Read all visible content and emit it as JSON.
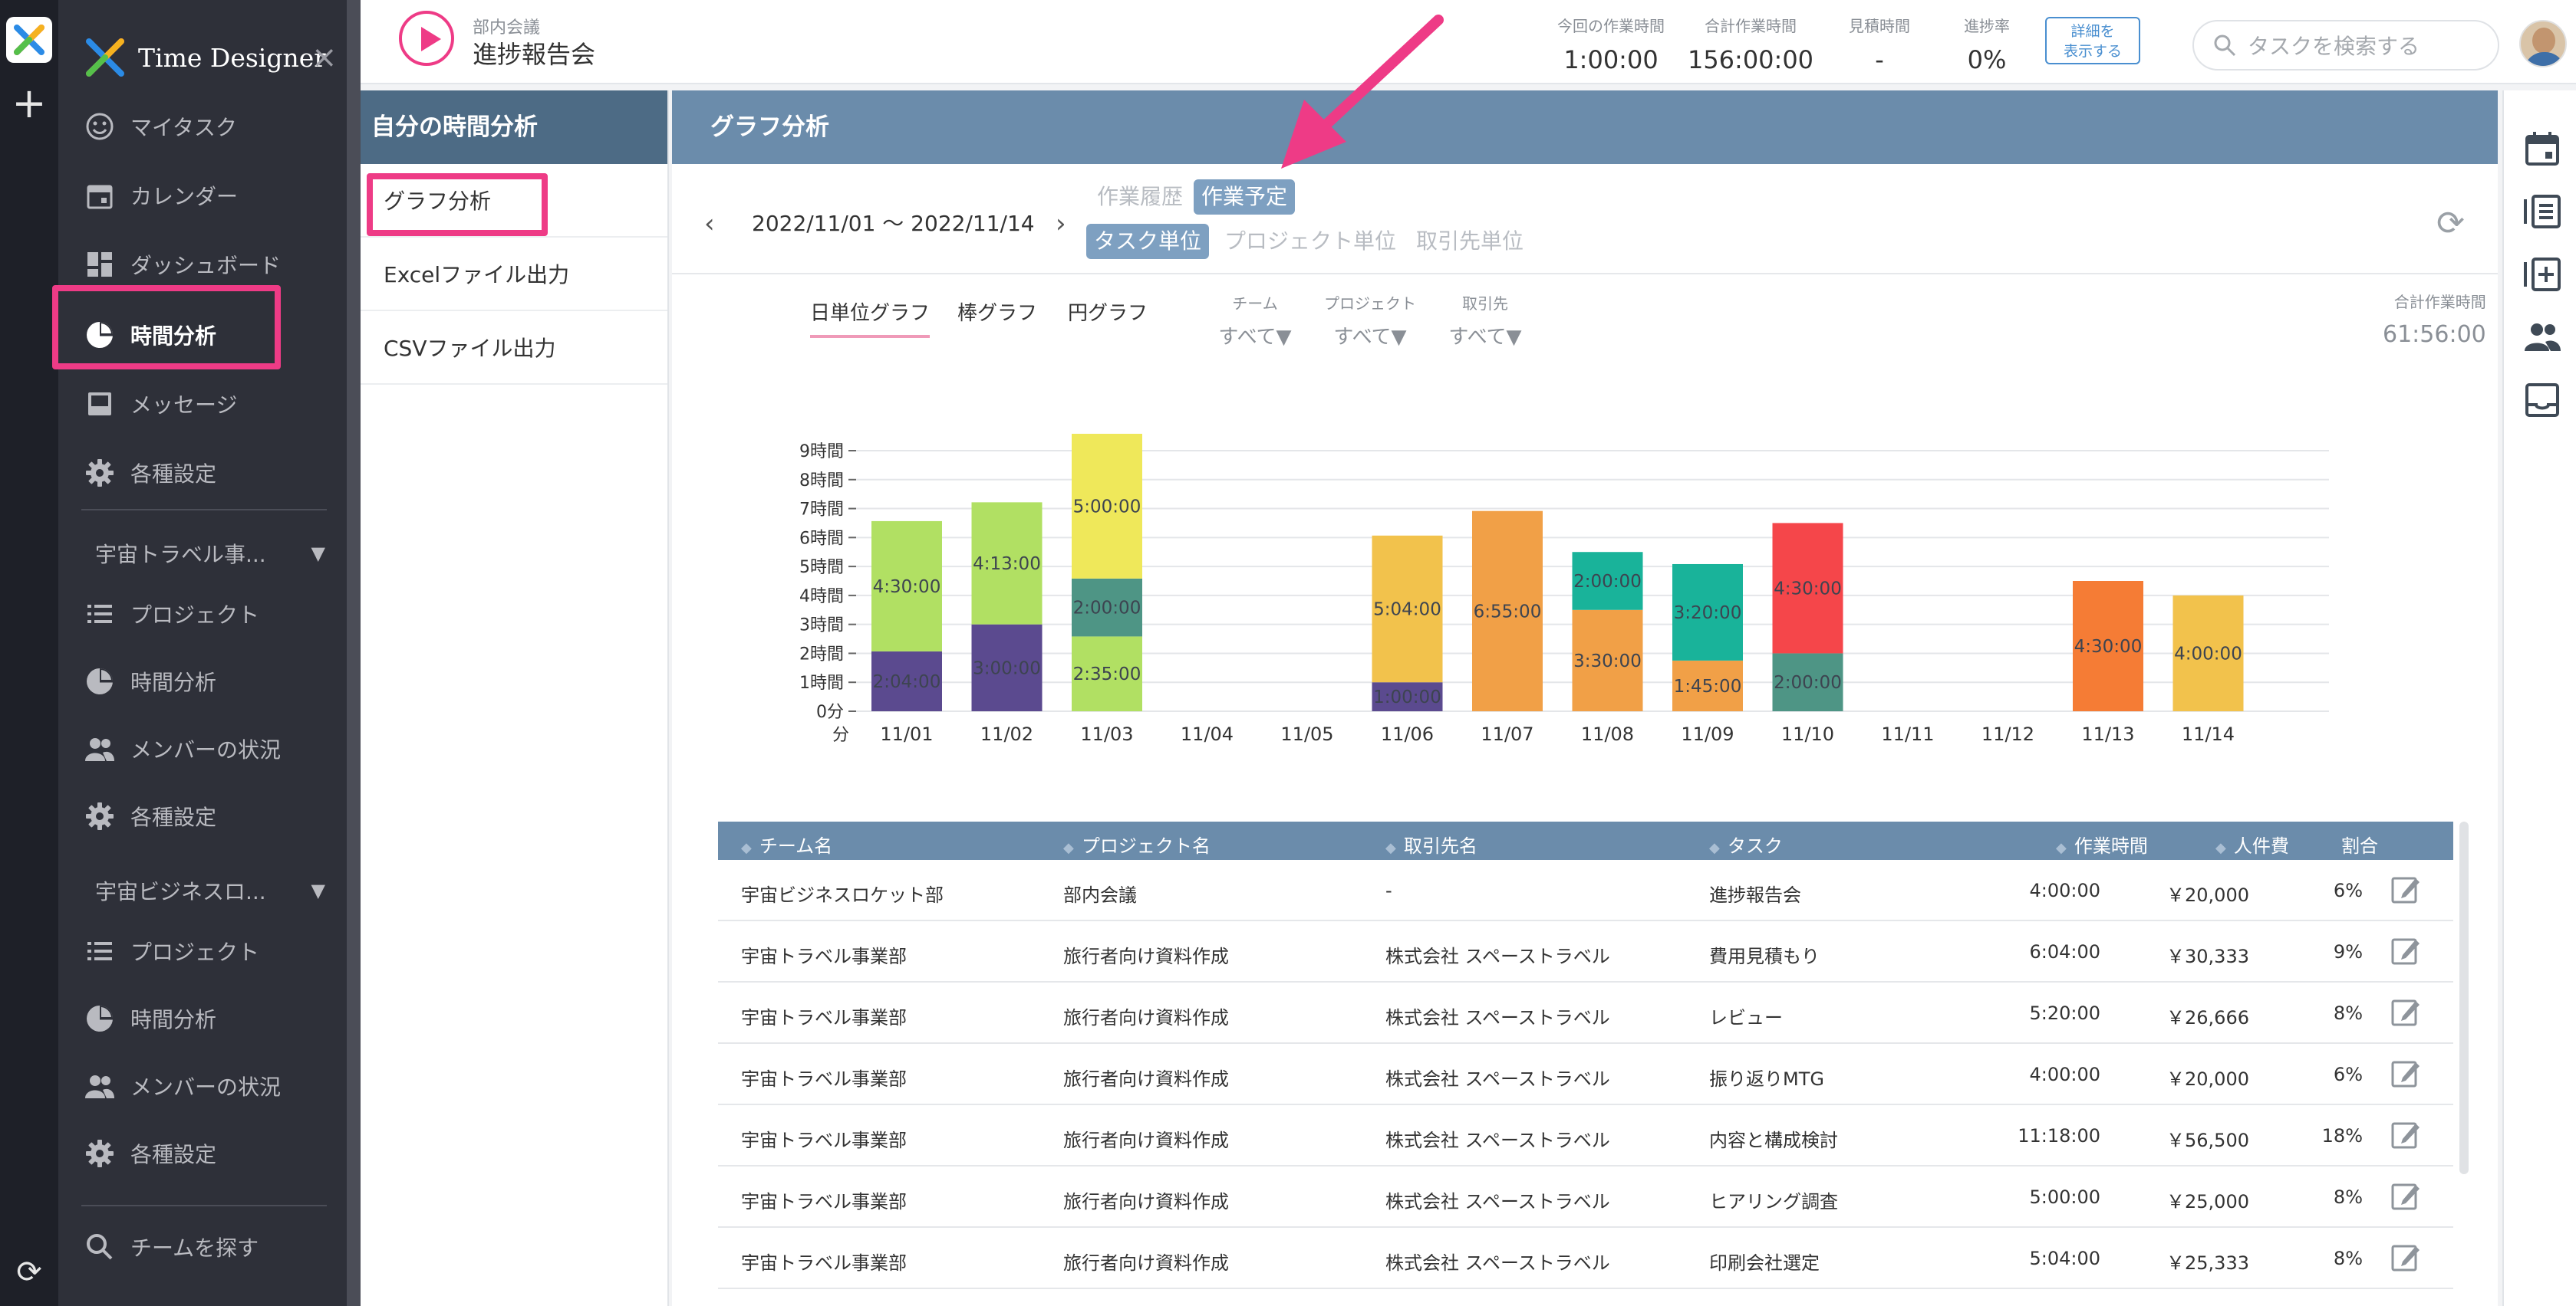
{
  "app": {
    "name": "Time Designer",
    "colors": {
      "accent": "#ee3b86",
      "sidebar": "#2e3039",
      "header": "#6b8cab",
      "subheader": "#4d6b85"
    }
  },
  "sidebar": {
    "items": [
      {
        "label": "マイタスク",
        "icon": "smiley-icon"
      },
      {
        "label": "カレンダー",
        "icon": "calendar-icon"
      },
      {
        "label": "ダッシュボード",
        "icon": "dashboard-icon"
      },
      {
        "label": "時間分析",
        "icon": "pie-chart-icon"
      },
      {
        "label": "メッセージ",
        "icon": "inbox-icon"
      },
      {
        "label": "各種設定",
        "icon": "gear-icon"
      }
    ],
    "groups": [
      {
        "name": "宇宙トラベル事...",
        "items": [
          {
            "label": "プロジェクト",
            "icon": "list-icon"
          },
          {
            "label": "時間分析",
            "icon": "pie-chart-icon"
          },
          {
            "label": "メンバーの状況",
            "icon": "people-icon"
          },
          {
            "label": "各種設定",
            "icon": "gear-icon"
          }
        ]
      },
      {
        "name": "宇宙ビジネスロ...",
        "items": [
          {
            "label": "プロジェクト",
            "icon": "list-icon"
          },
          {
            "label": "時間分析",
            "icon": "pie-chart-icon"
          },
          {
            "label": "メンバーの状況",
            "icon": "people-icon"
          },
          {
            "label": "各種設定",
            "icon": "gear-icon"
          }
        ]
      }
    ],
    "find_team": "チームを探す"
  },
  "topbar": {
    "task_category": "部内会議",
    "task_name": "進捗報告会",
    "stats": [
      {
        "label": "今回の作業時間",
        "value": "1:00:00"
      },
      {
        "label": "合計作業時間",
        "value": "156:00:00"
      },
      {
        "label": "見積時間",
        "value": "-"
      },
      {
        "label": "進捗率",
        "value": "0%"
      }
    ],
    "detail_button": [
      "詳細を",
      "表示する"
    ],
    "search_placeholder": "タスクを検索する"
  },
  "subnav": {
    "title": "自分の時間分析",
    "items": [
      "グラフ分析",
      "Excelファイル出力",
      "CSVファイル出力"
    ]
  },
  "main": {
    "title": "グラフ分析",
    "date_range": "2022/11/01 〜 2022/11/14",
    "mode_toggle": [
      {
        "label": "作業履歴",
        "active": false
      },
      {
        "label": "作業予定",
        "active": true
      }
    ],
    "unit_toggle": [
      {
        "label": "タスク単位",
        "active": true
      },
      {
        "label": "プロジェクト単位",
        "active": false
      },
      {
        "label": "取引先単位",
        "active": false
      }
    ],
    "chart_tabs": [
      "日単位グラフ",
      "棒グラフ",
      "円グラフ"
    ],
    "filters": [
      {
        "label": "チーム",
        "value": "すべて▼"
      },
      {
        "label": "プロジェクト",
        "value": "すべて▼"
      },
      {
        "label": "取引先",
        "value": "すべて▼"
      }
    ],
    "total_label": "合計作業時間",
    "total_value": "61:56:00"
  },
  "chart_data": {
    "type": "bar",
    "stacked": true,
    "categories": [
      "11/01",
      "11/02",
      "11/03",
      "11/04",
      "11/05",
      "11/06",
      "11/07",
      "11/08",
      "11/09",
      "11/10",
      "11/11",
      "11/12",
      "11/13",
      "11/14"
    ],
    "y_tick_labels": [
      "0分",
      "1時間",
      "2時間",
      "3時間",
      "4時間",
      "5時間",
      "6時間",
      "7時間",
      "8時間",
      "9時間"
    ],
    "x_corner_label": "分",
    "ylim": [
      0,
      9
    ],
    "grid": true,
    "stacks": [
      [
        {
          "value": 2.067,
          "label": "2:04:00",
          "color": "#5b4a8f"
        },
        {
          "value": 4.5,
          "label": "4:30:00",
          "color": "#b1e063"
        }
      ],
      [
        {
          "value": 3.0,
          "label": "3:00:00",
          "color": "#5b4a8f"
        },
        {
          "value": 4.217,
          "label": "4:13:00",
          "color": "#b1e063"
        }
      ],
      [
        {
          "value": 2.583,
          "label": "2:35:00",
          "color": "#b1e063"
        },
        {
          "value": 2.0,
          "label": "2:00:00",
          "color": "#4e9585"
        },
        {
          "value": 5.0,
          "label": "5:00:00",
          "color": "#efe85a"
        }
      ],
      [],
      [],
      [
        {
          "value": 1.0,
          "label": "1:00:00",
          "color": "#5b4a8f"
        },
        {
          "value": 5.067,
          "label": "5:04:00",
          "color": "#f2c24c"
        }
      ],
      [
        {
          "value": 6.917,
          "label": "6:55:00",
          "color": "#f1a047"
        }
      ],
      [
        {
          "value": 3.5,
          "label": "3:30:00",
          "color": "#f1a047"
        },
        {
          "value": 2.0,
          "label": "2:00:00",
          "color": "#19b39a"
        }
      ],
      [
        {
          "value": 1.75,
          "label": "1:45:00",
          "color": "#f1a047"
        },
        {
          "value": 3.333,
          "label": "3:20:00",
          "color": "#19b39a"
        }
      ],
      [
        {
          "value": 2.0,
          "label": "2:00:00",
          "color": "#4e9585"
        },
        {
          "value": 4.5,
          "label": "4:30:00",
          "color": "#f5464a"
        }
      ],
      [],
      [],
      [
        {
          "value": 4.5,
          "label": "4:30:00",
          "color": "#f57c35"
        }
      ],
      [
        {
          "value": 4.0,
          "label": "4:00:00",
          "color": "#f2c24c"
        }
      ]
    ]
  },
  "table": {
    "headers": [
      "チーム名",
      "プロジェクト名",
      "取引先名",
      "タスク",
      "作業時間",
      "人件費",
      "割合"
    ],
    "rows": [
      [
        "宇宙ビジネスロケット部",
        "部内会議",
        "-",
        "進捗報告会",
        "4:00:00",
        "￥20,000",
        "6%"
      ],
      [
        "宇宙トラベル事業部",
        "旅行者向け資料作成",
        "株式会社 スペーストラベル",
        "費用見積もり",
        "6:04:00",
        "￥30,333",
        "9%"
      ],
      [
        "宇宙トラベル事業部",
        "旅行者向け資料作成",
        "株式会社 スペーストラベル",
        "レビュー",
        "5:20:00",
        "￥26,666",
        "8%"
      ],
      [
        "宇宙トラベル事業部",
        "旅行者向け資料作成",
        "株式会社 スペーストラベル",
        "振り返りMTG",
        "4:00:00",
        "￥20,000",
        "6%"
      ],
      [
        "宇宙トラベル事業部",
        "旅行者向け資料作成",
        "株式会社 スペーストラベル",
        "内容と構成検討",
        "11:18:00",
        "￥56,500",
        "18%"
      ],
      [
        "宇宙トラベル事業部",
        "旅行者向け資料作成",
        "株式会社 スペーストラベル",
        "ヒアリング調査",
        "5:00:00",
        "￥25,000",
        "8%"
      ],
      [
        "宇宙トラベル事業部",
        "旅行者向け資料作成",
        "株式会社 スペーストラベル",
        "印刷会社選定",
        "5:04:00",
        "￥25,333",
        "8%"
      ]
    ]
  }
}
